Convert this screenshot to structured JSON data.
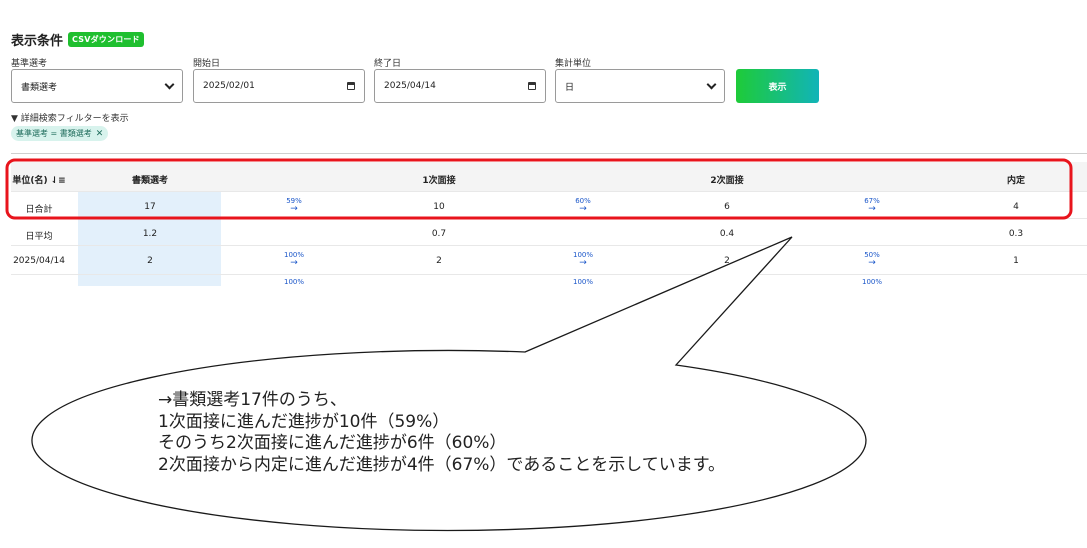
{
  "header": {
    "title": "表示条件",
    "csv_button": "CSVダウンロード"
  },
  "filters": {
    "criteria": {
      "label": "基準選考",
      "value": "書類選考"
    },
    "start_date": {
      "label": "開始日",
      "value": "2025/02/01"
    },
    "end_date": {
      "label": "終了日",
      "value": "2025/04/14"
    },
    "unit": {
      "label": "集計単位",
      "value": "日"
    },
    "show_button": "表示",
    "advanced_toggle": "▼ 詳細検索フィルターを表示",
    "active_chip": "基準選考 = 書類選考",
    "chip_remove": "✕"
  },
  "table": {
    "headers": [
      "単位(名)",
      "書類選考",
      "1次面接",
      "2次面接",
      "内定"
    ],
    "sort_icon": "⇃≡",
    "arrow": "→",
    "rows": [
      {
        "label": "日合計",
        "values": [
          "17",
          "10",
          "6",
          "4"
        ],
        "rates": [
          "59%",
          "60%",
          "67%"
        ]
      },
      {
        "label": "日平均",
        "values": [
          "1.2",
          "0.7",
          "0.4",
          "0.3"
        ]
      },
      {
        "label": "2025/04/14",
        "values": [
          "2",
          "2",
          "2",
          "1"
        ],
        "rates": [
          "100%",
          "100%",
          "50%"
        ]
      },
      {
        "rates": [
          "100%",
          "100%",
          "100%"
        ]
      }
    ]
  },
  "annotation": {
    "highlight_color": "#e8141c",
    "lines": [
      "→書類選考17件のうち、",
      "1次面接に進んだ進捗が10件（59%）",
      "そのうち2次面接に進んだ進捗が6件（60%）",
      "2次面接から内定に進んだ進捗が4件（67%）であることを示しています。"
    ]
  }
}
